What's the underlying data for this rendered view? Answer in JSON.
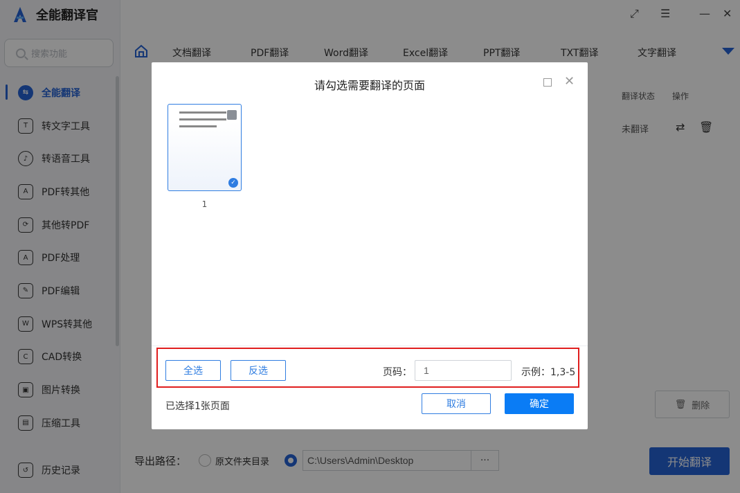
{
  "app": {
    "title": "全能翻译官",
    "search_placeholder": "搜索功能",
    "nav": [
      {
        "label": "全能翻译",
        "icon": "translate-icon"
      },
      {
        "label": "转文字工具",
        "icon": "text-tool-icon"
      },
      {
        "label": "转语音工具",
        "icon": "voice-tool-icon"
      },
      {
        "label": "PDF转其他",
        "icon": "pdf-convert-icon"
      },
      {
        "label": "其他转PDF",
        "icon": "to-pdf-icon"
      },
      {
        "label": "PDF处理",
        "icon": "pdf-process-icon"
      },
      {
        "label": "PDF编辑",
        "icon": "pdf-edit-icon"
      },
      {
        "label": "WPS转其他",
        "icon": "wps-icon"
      },
      {
        "label": "CAD转换",
        "icon": "cad-icon"
      },
      {
        "label": "图片转换",
        "icon": "image-icon"
      },
      {
        "label": "压缩工具",
        "icon": "compress-icon"
      }
    ],
    "history": "历史记录",
    "tabs": [
      "文档翻译",
      "PDF翻译",
      "Word翻译",
      "Excel翻译",
      "PPT翻译",
      "TXT翻译",
      "文字翻译"
    ],
    "table": {
      "col_status": "翻译状态",
      "col_action": "操作",
      "row_status": "未翻译"
    },
    "delete_label": "删除",
    "export_label": "导出路径：",
    "radio_original": "原文件夹目录",
    "export_path": "C:\\Users\\Admin\\Desktop",
    "browse": "···",
    "start_button": "开始翻译"
  },
  "dialog": {
    "title": "请勾选需要翻译的页面",
    "page_thumbnail_number": "1",
    "select_all": "全选",
    "invert": "反选",
    "page_label": "页码：",
    "page_input_value": "1",
    "example": "示例：1,3-5",
    "selected_info": "已选择1张页面",
    "cancel": "取消",
    "confirm": "确定"
  },
  "colors": {
    "accent": "#2563d6",
    "confirm": "#0a7cf5",
    "highlight": "#e01d1d"
  }
}
